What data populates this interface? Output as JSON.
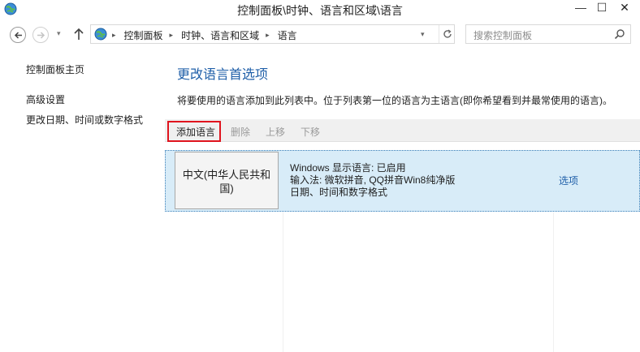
{
  "window": {
    "title": "控制面板\\时钟、语言和区域\\语言",
    "icon": "control-panel-globe-icon",
    "min_glyph": "—",
    "max_glyph": "☐",
    "close_glyph": "✕"
  },
  "address": {
    "crumbs": [
      "控制面板",
      "时钟、语言和区域",
      "语言"
    ],
    "crumb_separator": "▸",
    "dropdown_glyph": "▾"
  },
  "search": {
    "placeholder": "搜索控制面板"
  },
  "sidebar": {
    "home": "控制面板主页",
    "advanced": "高级设置",
    "date_format": "更改日期、时间或数字格式"
  },
  "main": {
    "heading": "更改语言首选项",
    "description": "将要使用的语言添加到此列表中。位于列表第一位的语言为主语言(即你希望看到并最常使用的语言)。",
    "toolbar": {
      "add": "添加语言",
      "remove": "删除",
      "move_up": "上移",
      "move_down": "下移"
    },
    "languages": [
      {
        "name": "中文(中华人民共和国)",
        "info_line1": "Windows 显示语言: 已启用",
        "info_line2": "输入法: 微软拼音, QQ拼音Win8纯净版",
        "info_line3": "日期、时间和数字格式",
        "options": "选项"
      }
    ]
  },
  "colors": {
    "accent_link": "#1e5ea8",
    "selected_row": "#d8ecf8",
    "highlight_box": "#e0141e",
    "disabled_text": "#9a9a9a"
  }
}
